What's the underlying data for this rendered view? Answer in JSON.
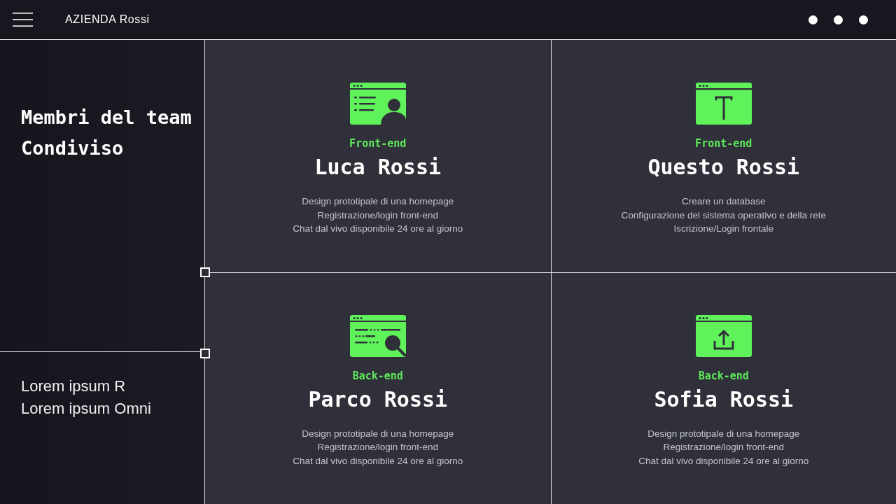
{
  "header": {
    "title": "AZIENDA Rossi"
  },
  "sidebar": {
    "title": "Membri del team Condiviso",
    "lines": [
      "Lorem ipsum R",
      "Lorem ipsum Omni"
    ]
  },
  "members": [
    {
      "kind": "profile",
      "role": "Front-end",
      "name": "Luca Rossi",
      "tasks": [
        "Design prototipale di una homepage",
        "Registrazione/login front-end",
        "Chat dal vivo disponibile 24 ore al giorno"
      ]
    },
    {
      "kind": "text",
      "role": "Front-end",
      "name": "Questo Rossi",
      "tasks": [
        "Creare un database",
        "Configurazione del sistema operativo e della rete",
        "Iscrizione/Login frontale"
      ]
    },
    {
      "kind": "search",
      "role": "Back-end",
      "name": "Parco Rossi",
      "tasks": [
        "Design prototipale di una homepage",
        "Registrazione/login front-end",
        "Chat dal vivo disponibile 24 ore al giorno"
      ]
    },
    {
      "kind": "upload",
      "role": "Back-end",
      "name": "Sofia Rossi",
      "tasks": [
        "Design prototipale di una homepage",
        "Registrazione/login front-end",
        "Chat dal vivo disponibile 24 ore al giorno"
      ]
    }
  ]
}
